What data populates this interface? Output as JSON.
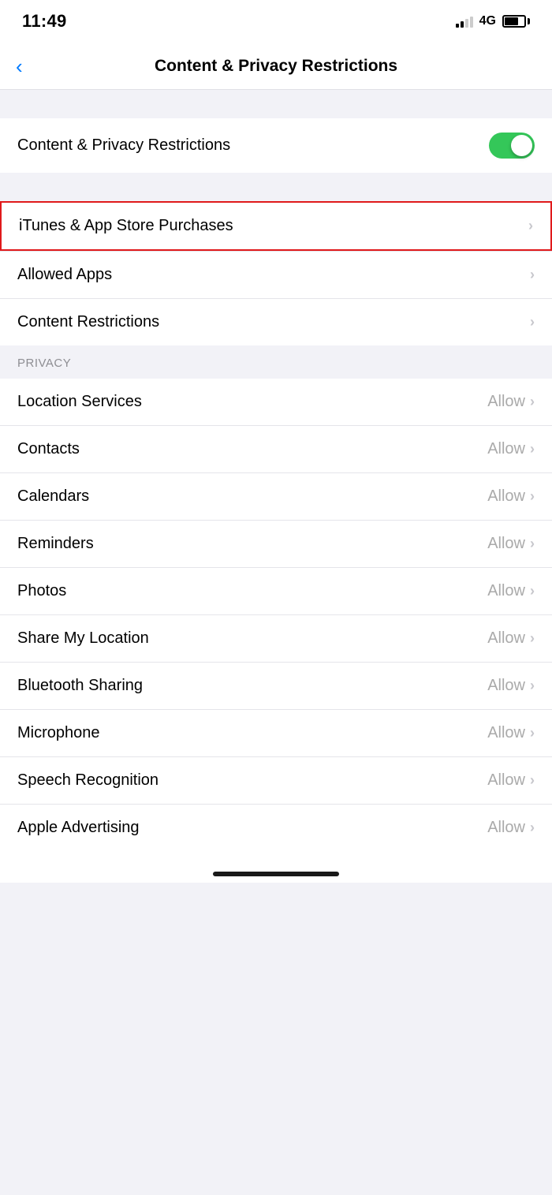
{
  "statusBar": {
    "time": "11:49",
    "network": "4G"
  },
  "navBar": {
    "backLabel": "",
    "title": "Content & Privacy Restrictions"
  },
  "mainToggle": {
    "label": "Content & Privacy Restrictions",
    "enabled": true
  },
  "purchasesRow": {
    "label": "iTunes & App Store Purchases",
    "highlighted": true
  },
  "allowedAppsRow": {
    "label": "Allowed Apps"
  },
  "contentRestrictionsRow": {
    "label": "Content Restrictions"
  },
  "privacySection": {
    "header": "PRIVACY",
    "rows": [
      {
        "label": "Location Services",
        "value": "Allow"
      },
      {
        "label": "Contacts",
        "value": "Allow"
      },
      {
        "label": "Calendars",
        "value": "Allow"
      },
      {
        "label": "Reminders",
        "value": "Allow"
      },
      {
        "label": "Photos",
        "value": "Allow"
      },
      {
        "label": "Share My Location",
        "value": "Allow"
      },
      {
        "label": "Bluetooth Sharing",
        "value": "Allow"
      },
      {
        "label": "Microphone",
        "value": "Allow"
      },
      {
        "label": "Speech Recognition",
        "value": "Allow"
      },
      {
        "label": "Apple Advertising",
        "value": "Allow"
      }
    ]
  },
  "chevron": "›"
}
